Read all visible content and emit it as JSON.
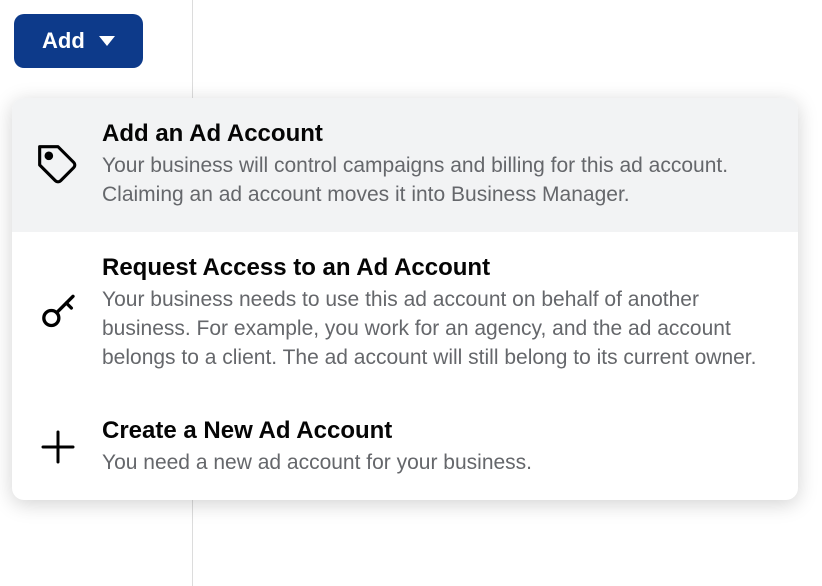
{
  "button": {
    "label": "Add"
  },
  "menu": {
    "items": [
      {
        "title": "Add an Ad Account",
        "desc": "Your business will control campaigns and billing for this ad account. Claiming an ad account moves it into Business Manager."
      },
      {
        "title": "Request Access to an Ad Account",
        "desc": "Your business needs to use this ad account on behalf of another business. For example, you work for an agency, and the ad account belongs to a client. The ad account will still belong to its current owner."
      },
      {
        "title": "Create a New Ad Account",
        "desc": "You need a new ad account for your business."
      }
    ]
  }
}
